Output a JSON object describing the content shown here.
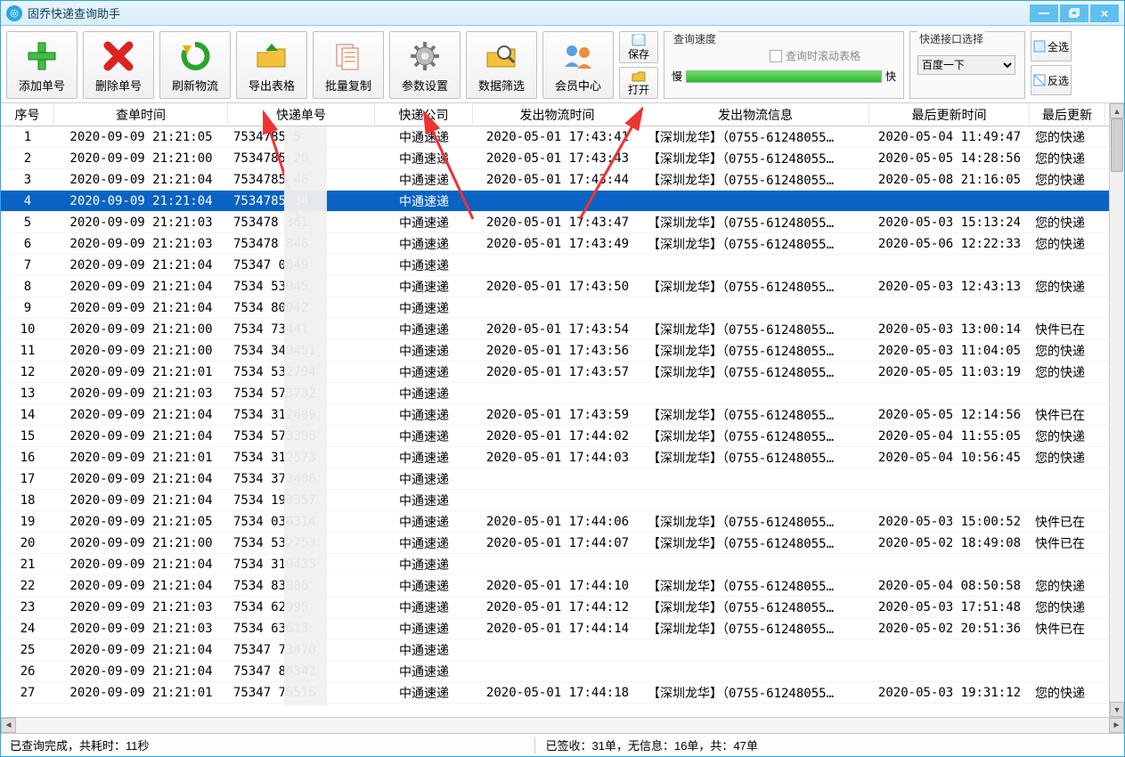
{
  "title": "固乔快递查询助手",
  "window": {
    "min": "min",
    "max": "max",
    "close": "×"
  },
  "toolbar": {
    "add": "添加单号",
    "del": "删除单号",
    "refresh": "刷新物流",
    "export": "导出表格",
    "copy": "批量复制",
    "params": "参数设置",
    "filter": "数据筛选",
    "member": "会员中心",
    "save": "保存",
    "open": "打开"
  },
  "speed": {
    "title": "查询速度",
    "scroll_label": "查询时滚动表格",
    "slow": "慢",
    "fast": "快"
  },
  "api": {
    "title": "快递接口选择",
    "selected": "百度一下"
  },
  "sel": {
    "all": "全选",
    "inv": "反选"
  },
  "columns": [
    "序号",
    "查单时间",
    "快递单号",
    "快递公司",
    "发出物流时间",
    "发出物流信息",
    "最后更新时间",
    "最后更新"
  ],
  "info_prefix": "【深圳龙华】（0755-61248055…",
  "msg_has": "您的快递",
  "msg_at": "快件已在",
  "rows": [
    {
      "n": 1,
      "t": "2020-09-09 21:21:05",
      "no": "7534785        5",
      "c": "中通速递",
      "st": "2020-05-01 17:43:41",
      "info": true,
      "ut": "2020-05-04 11:49:47",
      "m": "h"
    },
    {
      "n": 2,
      "t": "2020-09-09 21:21:00",
      "no": "7534785        20",
      "c": "中通速递",
      "st": "2020-05-01 17:43:43",
      "info": true,
      "ut": "2020-05-05 14:28:56",
      "m": "h"
    },
    {
      "n": 3,
      "t": "2020-09-09 21:21:04",
      "no": "7534785        46",
      "c": "中通速递",
      "st": "2020-05-01 17:43:44",
      "info": true,
      "ut": "2020-05-08 21:16:05",
      "m": "h"
    },
    {
      "n": 4,
      "t": "2020-09-09 21:21:04",
      "no": "7534785        34",
      "c": "中通速递",
      "st": "",
      "info": false,
      "ut": "",
      "m": "",
      "sel": true
    },
    {
      "n": 5,
      "t": "2020-09-09 21:21:03",
      "no": "753478         361",
      "c": "中通速递",
      "st": "2020-05-01 17:43:47",
      "info": true,
      "ut": "2020-05-03 15:13:24",
      "m": "h"
    },
    {
      "n": 6,
      "t": "2020-09-09 21:21:03",
      "no": "753478         846",
      "c": "中通速递",
      "st": "2020-05-01 17:43:49",
      "info": true,
      "ut": "2020-05-06 12:22:33",
      "m": "h"
    },
    {
      "n": 7,
      "t": "2020-09-09 21:21:04",
      "no": "75347          0849",
      "c": "中通速递",
      "st": "",
      "info": false,
      "ut": "",
      "m": ""
    },
    {
      "n": 8,
      "t": "2020-09-09 21:21:04",
      "no": "7534           53945",
      "c": "中通速递",
      "st": "2020-05-01 17:43:50",
      "info": true,
      "ut": "2020-05-03 12:43:13",
      "m": "h"
    },
    {
      "n": 9,
      "t": "2020-09-09 21:21:04",
      "no": "7534           80042",
      "c": "中通速递",
      "st": "",
      "info": false,
      "ut": "",
      "m": ""
    },
    {
      "n": 10,
      "t": "2020-09-09 21:21:00",
      "no": "7534          73441",
      "c": "中通速递",
      "st": "2020-05-01 17:43:54",
      "info": true,
      "ut": "2020-05-03 13:00:14",
      "m": "a"
    },
    {
      "n": 11,
      "t": "2020-09-09 21:21:00",
      "no": "7534          349451",
      "c": "中通速递",
      "st": "2020-05-01 17:43:56",
      "info": true,
      "ut": "2020-05-03 11:04:05",
      "m": "h"
    },
    {
      "n": 12,
      "t": "2020-09-09 21:21:01",
      "no": "7534          532794",
      "c": "中通速递",
      "st": "2020-05-01 17:43:57",
      "info": true,
      "ut": "2020-05-05 11:03:19",
      "m": "h"
    },
    {
      "n": 13,
      "t": "2020-09-09 21:21:03",
      "no": "7534          573732",
      "c": "中通速递",
      "st": "",
      "info": false,
      "ut": "",
      "m": ""
    },
    {
      "n": 14,
      "t": "2020-09-09 21:21:04",
      "no": "7534          312609",
      "c": "中通速递",
      "st": "2020-05-01 17:43:59",
      "info": true,
      "ut": "2020-05-05 12:14:56",
      "m": "a"
    },
    {
      "n": 15,
      "t": "2020-09-09 21:21:04",
      "no": "7534          573396",
      "c": "中通速递",
      "st": "2020-05-01 17:44:02",
      "info": true,
      "ut": "2020-05-04 11:55:05",
      "m": "h"
    },
    {
      "n": 16,
      "t": "2020-09-09 21:21:01",
      "no": "7534          312573",
      "c": "中通速递",
      "st": "2020-05-01 17:44:03",
      "info": true,
      "ut": "2020-05-04 10:56:45",
      "m": "h"
    },
    {
      "n": 17,
      "t": "2020-09-09 21:21:04",
      "no": "7534          373406",
      "c": "中通速递",
      "st": "",
      "info": false,
      "ut": "",
      "m": ""
    },
    {
      "n": 18,
      "t": "2020-09-09 21:21:04",
      "no": "7534          190357",
      "c": "中通速递",
      "st": "",
      "info": false,
      "ut": "",
      "m": ""
    },
    {
      "n": 19,
      "t": "2020-09-09 21:21:05",
      "no": "7534          036314",
      "c": "中通速递",
      "st": "2020-05-01 17:44:06",
      "info": true,
      "ut": "2020-05-03 15:00:52",
      "m": "a"
    },
    {
      "n": 20,
      "t": "2020-09-09 21:21:00",
      "no": "7534          532753",
      "c": "中通速递",
      "st": "2020-05-01 17:44:07",
      "info": true,
      "ut": "2020-05-02 18:49:08",
      "m": "a"
    },
    {
      "n": 21,
      "t": "2020-09-09 21:21:04",
      "no": "7534          310435",
      "c": "中通速递",
      "st": "",
      "info": false,
      "ut": "",
      "m": ""
    },
    {
      "n": 22,
      "t": "2020-09-09 21:21:04",
      "no": "7534          83006",
      "c": "中通速递",
      "st": "2020-05-01 17:44:10",
      "info": true,
      "ut": "2020-05-04 08:50:58",
      "m": "h"
    },
    {
      "n": 23,
      "t": "2020-09-09 21:21:03",
      "no": "7534          62995",
      "c": "中通速递",
      "st": "2020-05-01 17:44:12",
      "info": true,
      "ut": "2020-05-03 17:51:48",
      "m": "h"
    },
    {
      "n": 24,
      "t": "2020-09-09 21:21:03",
      "no": "7534          63613",
      "c": "中通速递",
      "st": "2020-05-01 17:44:14",
      "info": true,
      "ut": "2020-05-02 20:51:36",
      "m": "a"
    },
    {
      "n": 25,
      "t": "2020-09-09 21:21:04",
      "no": "75347         73470",
      "c": "中通速递",
      "st": "",
      "info": false,
      "ut": "",
      "m": ""
    },
    {
      "n": 26,
      "t": "2020-09-09 21:21:04",
      "no": "75347         86342",
      "c": "中通速递",
      "st": "",
      "info": false,
      "ut": "",
      "m": ""
    },
    {
      "n": 27,
      "t": "2020-09-09 21:21:01",
      "no": "75347         75515",
      "c": "中通速递",
      "st": "2020-05-01 17:44:18",
      "info": true,
      "ut": "2020-05-03 19:31:12",
      "m": "h"
    }
  ],
  "status": {
    "done": "已查询完成，共耗时：11秒",
    "counts": "已签收：31单，无信息：16单，共：47单"
  }
}
